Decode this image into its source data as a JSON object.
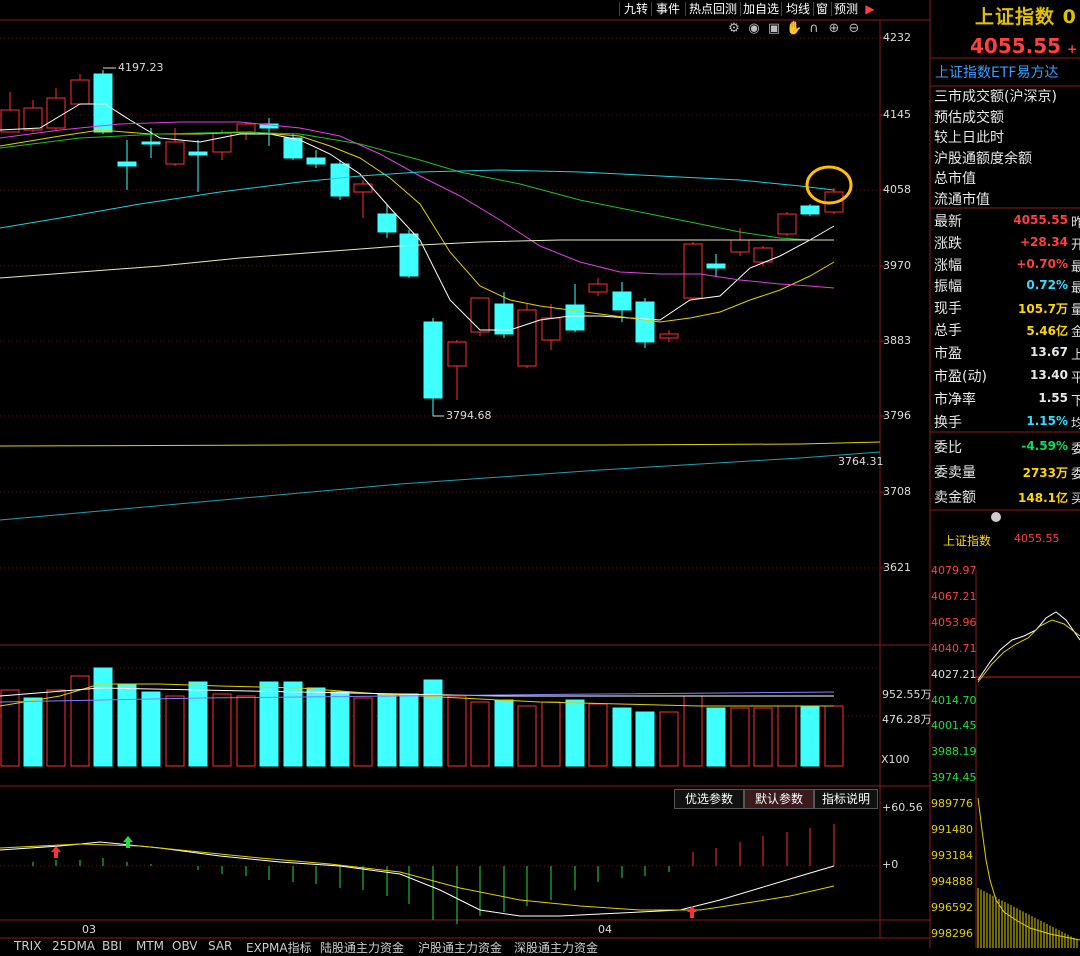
{
  "toolbar": {
    "buttons": [
      "九转",
      "事件",
      "热点回测",
      "加自选",
      "均线",
      "窗",
      "预测"
    ],
    "play_glyph": "▶"
  },
  "chart_icons": [
    "settings-icon",
    "eye-icon",
    "lock-icon",
    "hand-icon",
    "magnet-icon",
    "zoom-in-icon",
    "zoom-out-icon"
  ],
  "price_axis": {
    "ticks": [
      "4232",
      "4145",
      "4058",
      "3970",
      "3883",
      "3796",
      "3708",
      "3621"
    ]
  },
  "annotations": {
    "high": "4197.23",
    "low": "3794.68",
    "line_level": "3764.31"
  },
  "volume_axis": {
    "ticks": [
      "952.55万",
      "476.28万"
    ],
    "unit": "X100"
  },
  "indicator_axis": {
    "ticks": [
      "+60.56",
      "+0"
    ]
  },
  "indicator_tabs": [
    "优选参数",
    "默认参数",
    "指标说明"
  ],
  "date_labels": [
    "03",
    "04"
  ],
  "bottom_tabs": [
    "TRIX",
    "25DMA",
    "BBI",
    "MTM",
    "OBV",
    "SAR",
    "EXPMA指标",
    "陆股通主力资金",
    "沪股通主力资金",
    "深股通主力资金"
  ],
  "right_panel": {
    "title": "上证指数 0",
    "price": "4055.55",
    "price_suffix": "+",
    "etf_link": "上证指数ETF易方达",
    "section_labels": [
      "三市成交额(沪深京)",
      "预估成交额",
      "较上日此时",
      "沪股通额度余额",
      "总市值",
      "流通市值"
    ],
    "quote_rows": [
      {
        "label": "最新",
        "value": "4055.55",
        "tail": "昨",
        "color": "#ff4040"
      },
      {
        "label": "涨跌",
        "value": "+28.34",
        "tail": "开",
        "color": "#ff4040"
      },
      {
        "label": "涨幅",
        "value": "+0.70%",
        "tail": "最",
        "color": "#ff4040"
      },
      {
        "label": "振幅",
        "value": "0.72%",
        "tail": "最",
        "color": "#33ddff"
      },
      {
        "label": "现手",
        "value": "105.7万",
        "tail": "量",
        "color": "#ffd700"
      },
      {
        "label": "总手",
        "value": "5.46亿",
        "tail": "金",
        "color": "#ffd700"
      },
      {
        "label": "市盈",
        "value": "13.67",
        "tail": "上",
        "color": "#e8e8e8"
      },
      {
        "label": "市盈(动)",
        "value": "13.40",
        "tail": "平",
        "color": "#e8e8e8"
      },
      {
        "label": "市净率",
        "value": "1.55",
        "tail": "下",
        "color": "#e8e8e8"
      },
      {
        "label": "换手",
        "value": "1.15%",
        "tail": "均",
        "color": "#33ddff"
      },
      {
        "label": "委比",
        "value": "-4.59%",
        "tail": "委",
        "color": "#00e060"
      },
      {
        "label": "委卖量",
        "value": "2733万",
        "tail": "委",
        "color": "#ffd700"
      },
      {
        "label": "卖金额",
        "value": "148.1亿",
        "tail": "买",
        "color": "#ffd700"
      }
    ],
    "mini_title": "上证指数",
    "mini_price": "4055.55",
    "mini_axis": [
      "4079.97",
      "4067.21",
      "4053.96",
      "4040.71",
      "4027.21",
      "4014.70",
      "4001.45",
      "3988.19",
      "3974.45",
      "989776",
      "991480",
      "993184",
      "994888",
      "996592",
      "998296"
    ]
  }
}
